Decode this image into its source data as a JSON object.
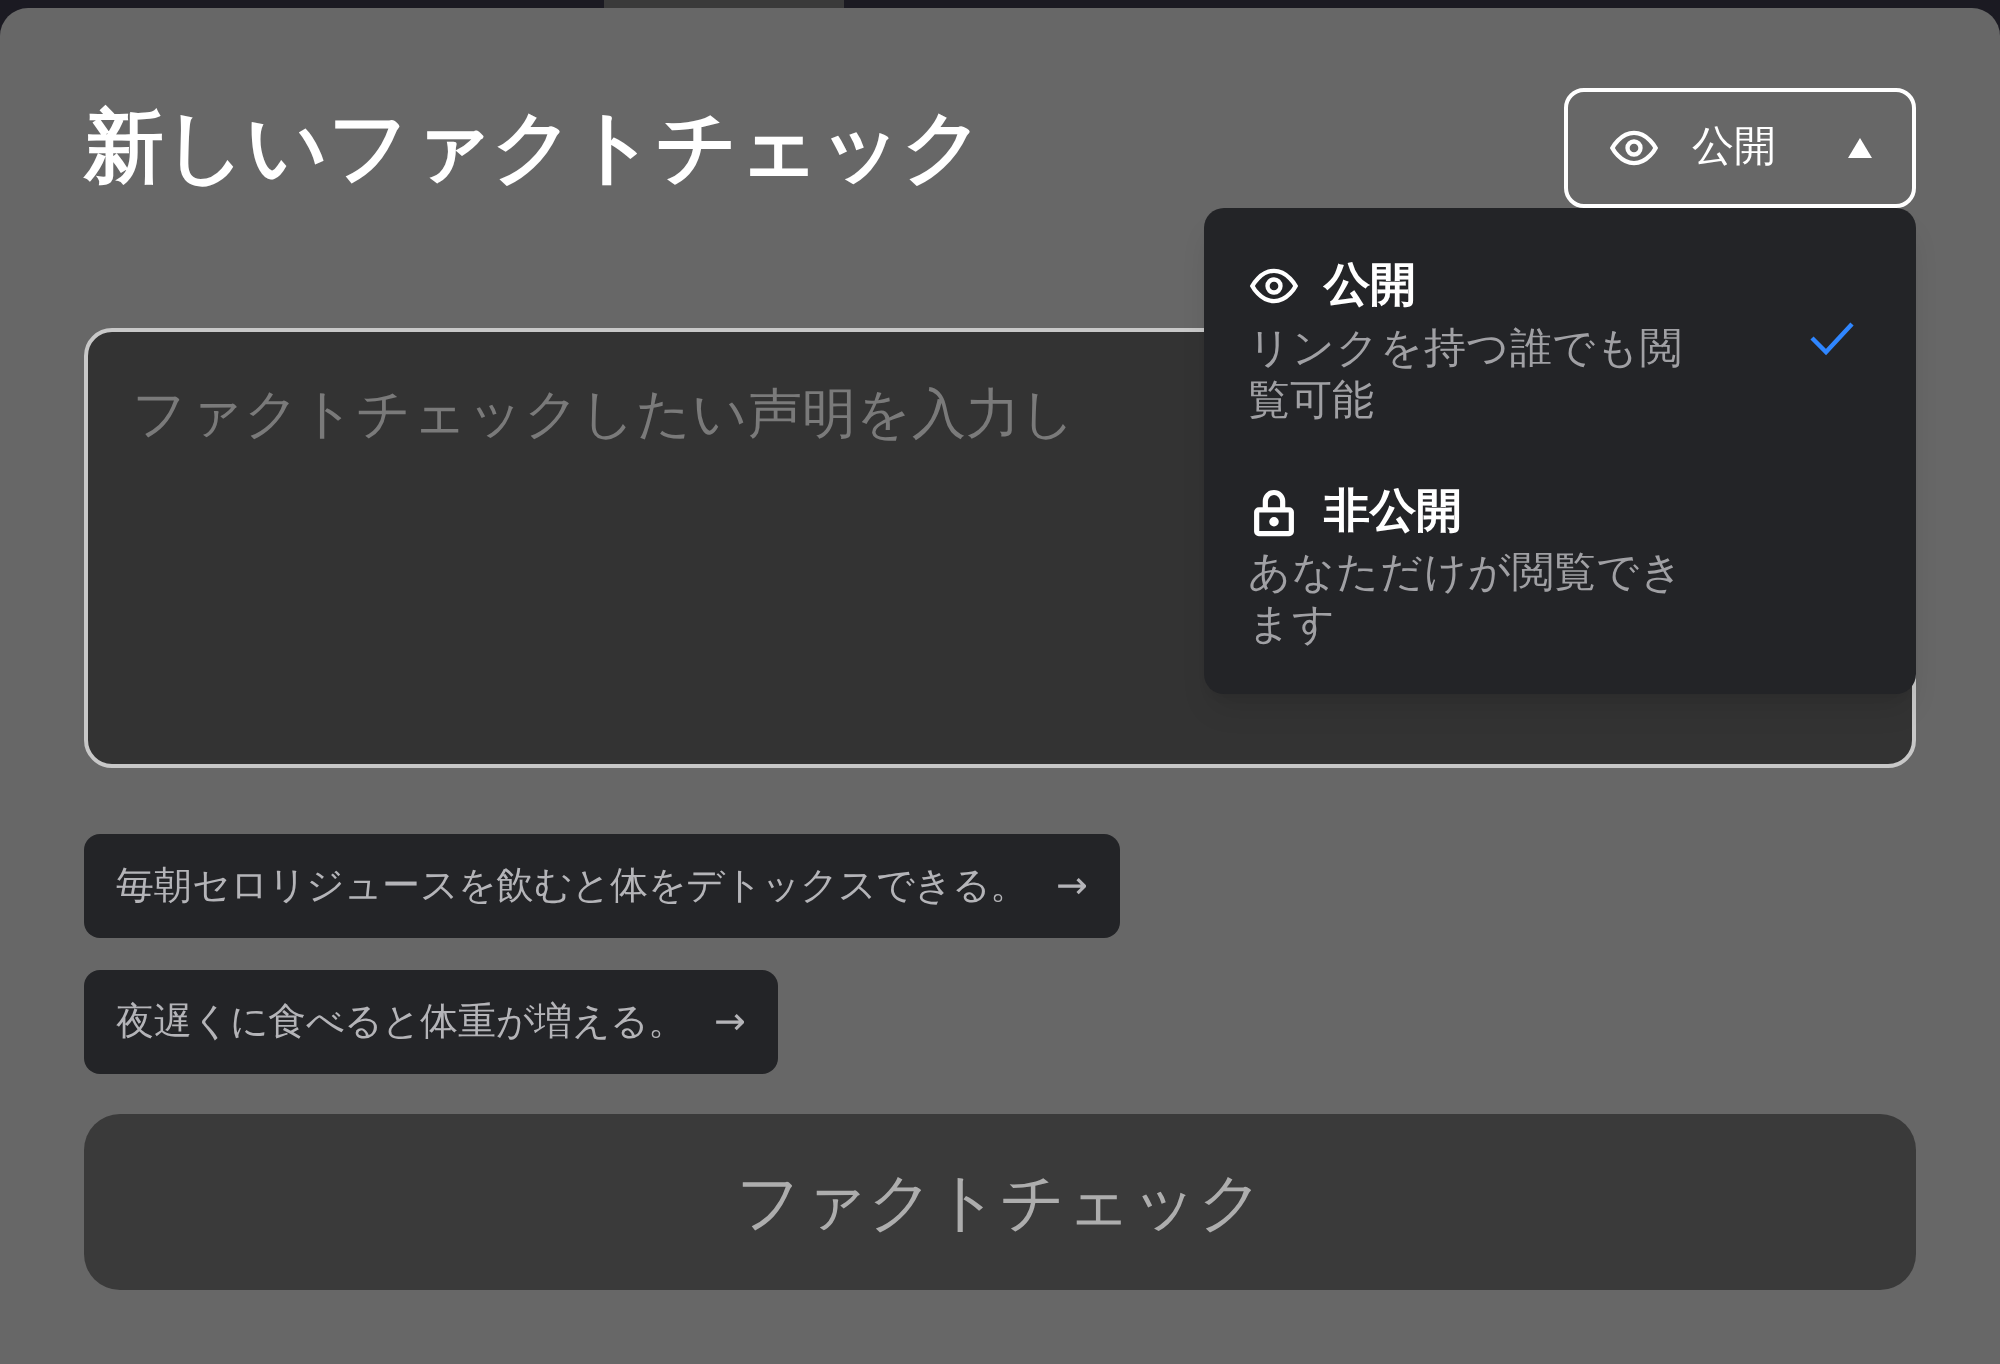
{
  "title": "新しいファクトチェック",
  "visibility": {
    "label": "公開",
    "kind": "eye",
    "expanded": true,
    "options": [
      {
        "label": "公開",
        "description": "リンクを持つ誰でも閲覧可能",
        "kind": "eye",
        "selected": true
      },
      {
        "label": "非公開",
        "description": "あなただけが閲覧できます",
        "kind": "lock",
        "selected": false
      }
    ]
  },
  "statement": {
    "placeholder": "ファクトチェックしたい声明を入力し"
  },
  "suggestions": [
    {
      "text": "毎朝セロリジュースを飲むと体をデトックスできる。",
      "arrow": "→"
    },
    {
      "text": "夜遅くに食べると体重が増える。",
      "arrow": "→"
    }
  ],
  "submit": {
    "label": "ファクトチェック",
    "disabled": true
  }
}
